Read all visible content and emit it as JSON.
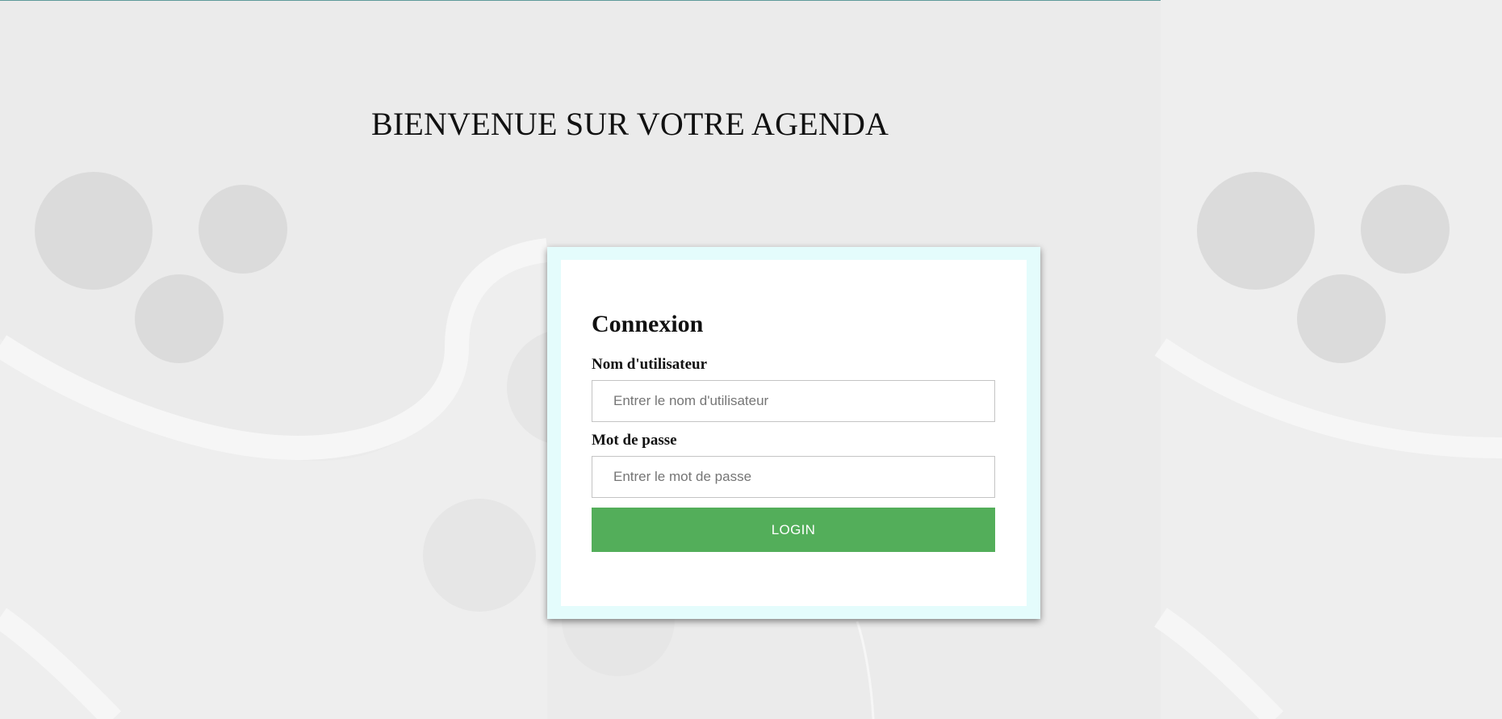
{
  "page": {
    "title": "BIENVENUE SUR VOTRE AGENDA"
  },
  "login_form": {
    "heading": "Connexion",
    "username_label": "Nom d'utilisateur",
    "username_placeholder": "Entrer le nom d'utilisateur",
    "username_value": "",
    "password_label": "Mot de passe",
    "password_placeholder": "Entrer le mot de passe",
    "password_value": "",
    "submit_label": "LOGIN"
  },
  "colors": {
    "background": "#ebebeb",
    "card_border": "#e4fcfc",
    "card_background": "#ffffff",
    "button_background": "#53ae5a",
    "button_text": "#ffffff",
    "decorative_circles": "#dcdcdc",
    "decorative_waves": "#f5f5f5"
  }
}
